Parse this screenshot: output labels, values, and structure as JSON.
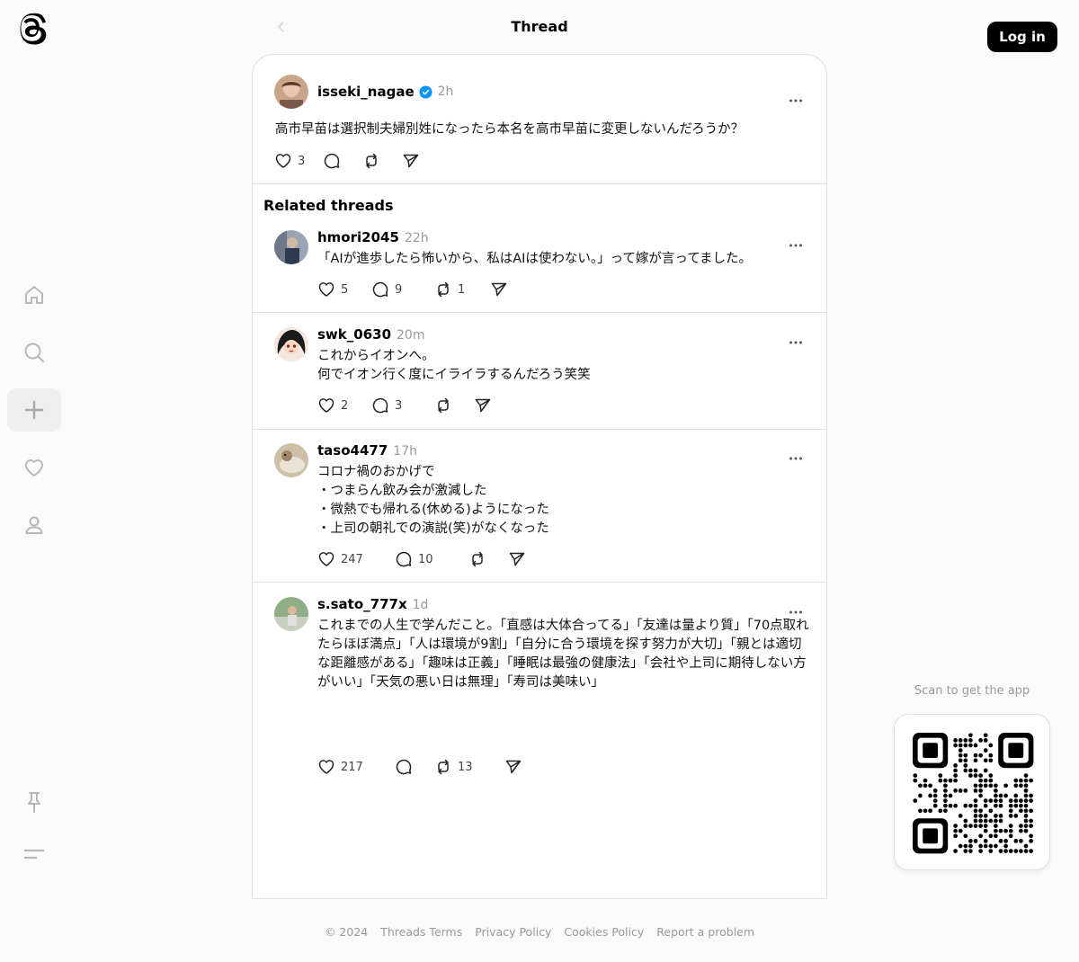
{
  "header": {
    "title": "Thread",
    "login_label": "Log in"
  },
  "nav": {
    "items": [
      "home-icon",
      "search-icon",
      "create-icon",
      "activity-icon",
      "profile-icon"
    ],
    "bottom": [
      "pin-icon",
      "menu-icon"
    ]
  },
  "main_post": {
    "username": "isseki_nagae",
    "verified": true,
    "time": "2h",
    "text": "高市早苗は選択制夫婦別姓になったら本名を高市早苗に変更しないんだろうか？",
    "likes": "3",
    "replies": "",
    "reposts": ""
  },
  "related": {
    "title": "Related threads",
    "posts": [
      {
        "username": "hmori2045",
        "time": "22h",
        "text": "「AIが進歩したら怖いから、私はAIは使わない。」って嫁が言ってました。",
        "likes": "5",
        "replies": "9",
        "reposts": "1"
      },
      {
        "username": "swk_0630",
        "time": "20m",
        "text": "これからイオンへ。\n何でイオン行く度にイライラするんだろう笑笑",
        "likes": "2",
        "replies": "3",
        "reposts": ""
      },
      {
        "username": "taso4477",
        "time": "17h",
        "text": "コロナ禍のおかげで\n・つまらん飲み会が激減した\n・微熱でも帰れる(休める)ようになった\n・上司の朝礼での演説(笑)がなくなった",
        "likes": "247",
        "replies": "10",
        "reposts": ""
      },
      {
        "username": "s.sato_777x",
        "time": "1d",
        "text": "これまでの人生で学んだこと。「直感は大体合ってる」「友達は量より質」「70点取れたらほぼ満点」「人は環境が9割」「自分に合う環境を探す努力が大切」「親とは適切な距離感がある」「趣味は正義」「睡眠は最強の健康法」「会社や上司に期待しない方がいい」「天気の悪い日は無理」「寿司は美味い」",
        "likes": "217",
        "replies": "",
        "reposts": "13"
      }
    ]
  },
  "qr": {
    "label": "Scan to get the app"
  },
  "footer": {
    "copyright": "© 2024",
    "terms": "Threads Terms",
    "privacy": "Privacy Policy",
    "cookies": "Cookies Policy",
    "report": "Report a problem"
  },
  "colors": {
    "verified": "#0095f6",
    "muted": "#999999",
    "border": "#e0e0e0"
  }
}
